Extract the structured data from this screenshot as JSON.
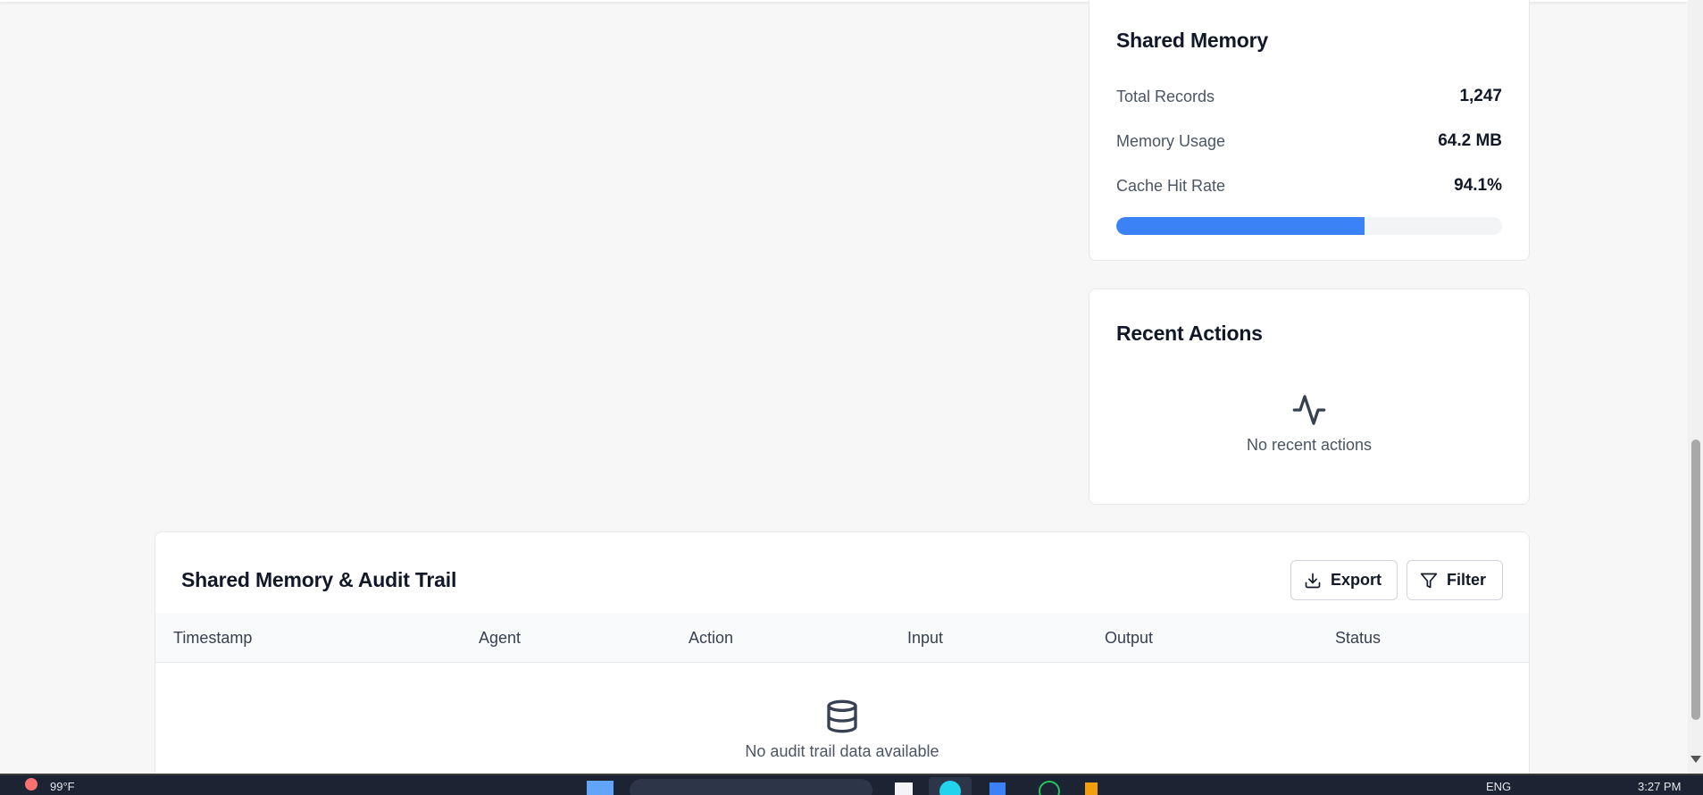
{
  "shared_memory": {
    "title": "Shared Memory",
    "stats": [
      {
        "label": "Total Records",
        "value": "1,247"
      },
      {
        "label": "Memory Usage",
        "value": "64.2 MB"
      },
      {
        "label": "Cache Hit Rate",
        "value": "94.1%"
      }
    ],
    "progress_fraction": 0.644,
    "progress_color": "#3b82f6"
  },
  "recent_actions": {
    "title": "Recent Actions",
    "icon": "activity-icon",
    "empty_text": "No recent actions"
  },
  "audit_trail": {
    "title": "Shared Memory & Audit Trail",
    "export_label": "Export",
    "filter_label": "Filter",
    "columns": [
      "Timestamp",
      "Agent",
      "Action",
      "Input",
      "Output",
      "Status"
    ],
    "empty_icon": "database-icon",
    "empty_text": "No audit trail data available"
  },
  "taskbar": {
    "weather": "99°F",
    "language": "ENG",
    "time": "3:27 PM"
  }
}
